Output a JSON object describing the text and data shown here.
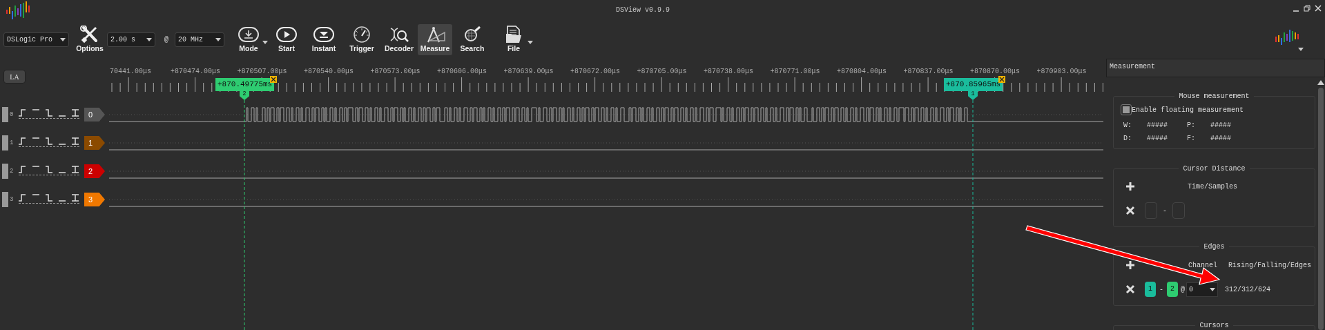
{
  "window": {
    "title": "DSView v0.9.9"
  },
  "toolbar": {
    "items": [
      {
        "kind": "select",
        "value": "DSLogic Pro"
      },
      {
        "kind": "button",
        "label": "Options",
        "selected": false,
        "dropdown": false
      },
      {
        "kind": "select",
        "value": "2.00 s"
      },
      {
        "kind": "text",
        "text": "@"
      },
      {
        "kind": "select",
        "value": "20 MHz"
      },
      {
        "kind": "button",
        "label": "Mode",
        "selected": false,
        "dropdown": true
      },
      {
        "kind": "button",
        "label": "Start",
        "selected": false,
        "dropdown": false
      },
      {
        "kind": "button",
        "label": "Instant",
        "selected": false,
        "dropdown": false
      },
      {
        "kind": "button",
        "label": "Trigger",
        "selected": false,
        "dropdown": false
      },
      {
        "kind": "button",
        "label": "Decoder",
        "selected": false,
        "dropdown": false
      },
      {
        "kind": "button",
        "label": "Measure",
        "selected": true,
        "dropdown": false
      },
      {
        "kind": "button",
        "label": "Search",
        "selected": false,
        "dropdown": false
      },
      {
        "kind": "button",
        "label": "File",
        "selected": false,
        "dropdown": true
      }
    ]
  },
  "mode_badge": "LA",
  "ruler": {
    "labels": [
      "70441.00μs",
      "+870474.00μs",
      "+870507.00μs",
      "+870540.00μs",
      "+870573.00μs",
      "+870606.00μs",
      "+870639.00μs",
      "+870672.00μs",
      "+870705.00μs",
      "+870738.00μs",
      "+870771.00μs",
      "+870804.00μs",
      "+870837.00μs",
      "+870870.00μs",
      "+870903.00μs"
    ]
  },
  "cursors": [
    {
      "time": "+870.49775ms",
      "number": "2",
      "color": "#2ecc71"
    },
    {
      "time": "+870.85965ms",
      "number": "1",
      "color": "#1abc9c"
    }
  ],
  "channels": [
    {
      "index": "0",
      "label": "0",
      "color": "#555555",
      "kind": "pulses"
    },
    {
      "index": "1",
      "label": "1",
      "color": "#8b4a00",
      "kind": "flat"
    },
    {
      "index": "2",
      "label": "2",
      "color": "#cc0000",
      "kind": "flat"
    },
    {
      "index": "3",
      "label": "3",
      "color": "#f07800",
      "kind": "flat"
    }
  ],
  "measurement_panel": {
    "title": "Measurement",
    "mouse": {
      "title": "Mouse measurement",
      "enable_label": "Enable floating measurement",
      "checked": true,
      "fields": [
        {
          "label": "W:",
          "value": "#####"
        },
        {
          "label": "P:",
          "value": "#####"
        },
        {
          "label": "D:",
          "value": "#####"
        },
        {
          "label": "F:",
          "value": "#####"
        }
      ]
    },
    "cursor_distance": {
      "title": "Cursor Distance",
      "column": "Time/Samples",
      "rows": [
        {
          "separator": "-"
        }
      ]
    },
    "edges": {
      "title": "Edges",
      "columns": [
        "Channel",
        "Rising/Falling/Edges"
      ],
      "rows": [
        {
          "badges": [
            {
              "label": "1",
              "color": "#1abc9c"
            },
            {
              "label": "2",
              "color": "#2ecc71"
            }
          ],
          "separator": "-",
          "at": "@",
          "channel": "0",
          "result": "312/312/624"
        }
      ]
    },
    "cursors_group": {
      "title": "Cursors"
    }
  },
  "annotation": {
    "kind": "arrow",
    "color": "#ff0000"
  }
}
